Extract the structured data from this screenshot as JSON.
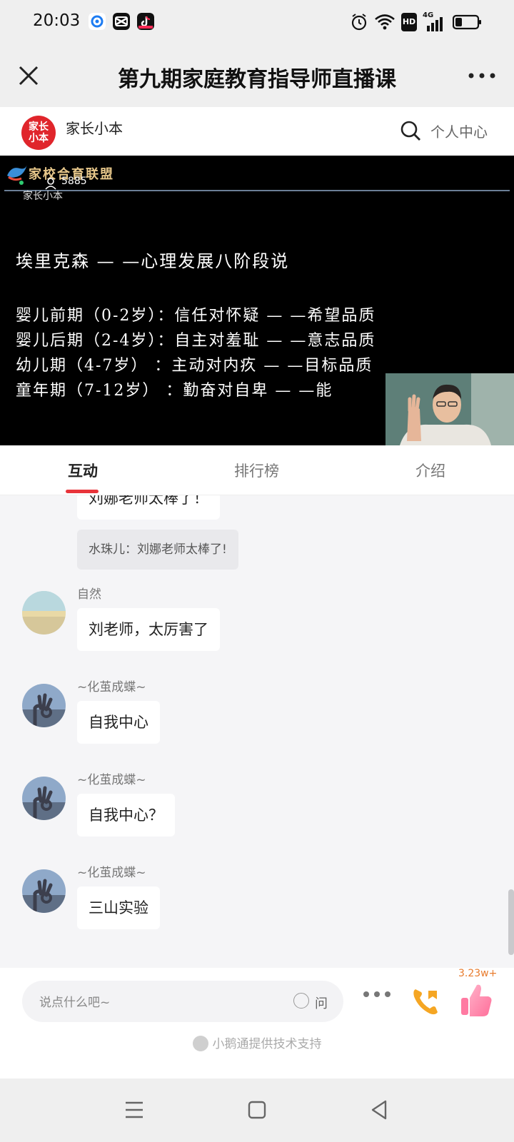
{
  "status_bar": {
    "time": "20:03",
    "app_icons": [
      "qq-browser-icon",
      "capcut-icon",
      "tiktok-icon"
    ],
    "right_icons": [
      "alarm-icon",
      "wifi-icon",
      "hd-icon",
      "4g-signal-icon",
      "battery-icon"
    ],
    "hd": "HD",
    "network": "4G"
  },
  "title_bar": {
    "title": "第九期家庭教育指导师直播课"
  },
  "channel": {
    "logo_text": "家长小本",
    "name": "家长小本",
    "personal_center": "个人中心"
  },
  "video": {
    "brand": "家校合育联盟",
    "viewer_count": "5885",
    "sub_name": "家长小本",
    "heading": "埃里克森 — —心理发展八阶段说",
    "stages": [
      "婴儿前期（0-2岁）：信任对怀疑 — —希望品质",
      "婴儿后期（2-4岁）：自主对羞耻 — —意志品质",
      "幼儿期（4-7岁）  ：主动对内疚 — —目标品质",
      "童年期（7-12岁） ：勤奋对自卑 — —能"
    ]
  },
  "tabs": [
    {
      "label": "互动",
      "active": true
    },
    {
      "label": "排行榜",
      "active": false
    },
    {
      "label": "介绍",
      "active": false
    }
  ],
  "chat": {
    "partial_message": "刘娜老师太棒了！",
    "quote": "水珠儿：刘娜老师太棒了!",
    "messages": [
      {
        "user": "自然",
        "text": "刘老师，太厉害了",
        "avatar": "landscape-avatar"
      },
      {
        "user": "~化茧成蝶~",
        "text": "自我中心",
        "avatar": "hand-sky-avatar"
      },
      {
        "user": "~化茧成蝶~",
        "text": "自我中心？",
        "avatar": "hand-sky-avatar"
      },
      {
        "user": "~化茧成蝶~",
        "text": "三山实验",
        "avatar": "hand-sky-avatar"
      }
    ]
  },
  "bottom_bar": {
    "input_placeholder": "说点什么吧~",
    "ask_label": "问",
    "like_count": "3.23w+",
    "powered_by": "小鹅通提供技术支持"
  },
  "colors": {
    "accent": "#e8343a",
    "like_count": "#e87b2c",
    "video_bg": "#000000"
  }
}
